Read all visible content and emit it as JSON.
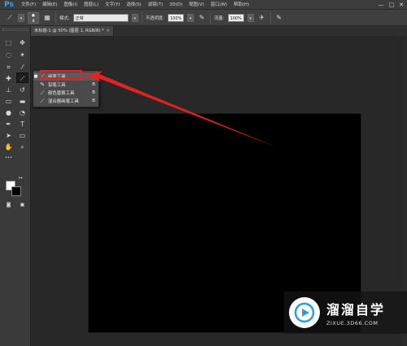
{
  "app": {
    "logo": "Ps",
    "window_controls": [
      "—",
      "□",
      "✕"
    ]
  },
  "menu": [
    "文件(F)",
    "编辑(E)",
    "图像(I)",
    "图层(L)",
    "文字(Y)",
    "选择(S)",
    "滤镜(T)",
    "3D(D)",
    "视图(V)",
    "窗口(W)",
    "帮助(H)"
  ],
  "options": {
    "brush_size": "8",
    "mode_label": "模式:",
    "mode_value": "正常",
    "opacity_label": "不透明度:",
    "opacity_value": "100%",
    "flow_label": "流量:",
    "flow_value": "100%"
  },
  "document": {
    "tab_title": "未标题-1 @ 50% (图层 1, RGB/8) *",
    "close": "×"
  },
  "toolbar": {
    "tools": [
      "marquee-icon",
      "move-icon",
      "lasso-icon",
      "magic-wand-icon",
      "crop-icon",
      "eyedropper-icon",
      "healing-brush-icon",
      "brush-icon",
      "clone-stamp-icon",
      "history-brush-icon",
      "eraser-icon",
      "gradient-icon",
      "blur-icon",
      "dodge-icon",
      "pen-icon",
      "type-icon",
      "path-select-icon",
      "rectangle-icon",
      "hand-icon",
      "zoom-icon"
    ],
    "foreground_color": "#ffffff",
    "background_color": "#000000"
  },
  "flyout": {
    "items": [
      {
        "label": "画笔工具",
        "key": "B",
        "icon": "brush-icon",
        "selected": true
      },
      {
        "label": "铅笔工具",
        "key": "B",
        "icon": "pencil-icon",
        "selected": false
      },
      {
        "label": "颜色替换工具",
        "key": "B",
        "icon": "color-replace-icon",
        "selected": false
      },
      {
        "label": "混合器画笔工具",
        "key": "B",
        "icon": "mixer-brush-icon",
        "selected": false
      }
    ]
  },
  "colors": {
    "highlight": "#e02424",
    "canvas": "#000000",
    "ui_bg": "#282828"
  },
  "watermark": {
    "title": "溜溜自学",
    "url": "ZIXUE.3D66.COM"
  }
}
